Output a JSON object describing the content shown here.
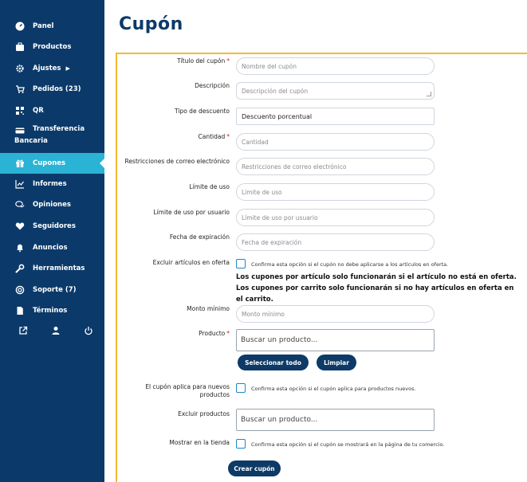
{
  "sidebar": {
    "items": [
      {
        "label": "Panel",
        "icon": "dashboard-icon"
      },
      {
        "label": "Productos",
        "icon": "briefcase-icon"
      },
      {
        "label": "Ajustes",
        "icon": "gear-icon"
      },
      {
        "label": "Pedidos (23)",
        "icon": "cart-icon"
      },
      {
        "label": "QR",
        "icon": "qr-icon"
      },
      {
        "label": "Transferencia",
        "label2": "Bancaria",
        "icon": "credit-card-icon"
      },
      {
        "label": "Cupones",
        "icon": "gift-icon",
        "active": true
      },
      {
        "label": "Informes",
        "icon": "chart-line-icon"
      },
      {
        "label": "Opiniones",
        "icon": "comments-icon"
      },
      {
        "label": "Seguidores",
        "icon": "heart-icon"
      },
      {
        "label": "Anuncios",
        "icon": "bell-icon"
      },
      {
        "label": "Herramientas",
        "icon": "wrench-icon"
      },
      {
        "label": "Soporte (7)",
        "icon": "lifebuoy-icon"
      },
      {
        "label": "Términos",
        "icon": "document-icon"
      }
    ],
    "ajustes_caret": "▶",
    "bottom_icons": [
      "external-link-icon",
      "user-icon",
      "power-icon"
    ]
  },
  "page": {
    "title": "Cupón"
  },
  "form": {
    "titulo": {
      "label": "Título del cupón",
      "required": "*",
      "placeholder": "Nombre del cupón"
    },
    "descripcion": {
      "label": "Descripción",
      "placeholder": "Descripción del cupón"
    },
    "tipo": {
      "label": "Tipo de descuento",
      "value": "Descuento porcentual"
    },
    "cantidad": {
      "label": "Cantidad",
      "required": "*",
      "placeholder": "Cantidad"
    },
    "restricciones": {
      "label": "Restricciones de correo electrónico",
      "placeholder": "Restricciones de correo electrónico"
    },
    "limite": {
      "label": "Límite de uso",
      "placeholder": "Límite de uso"
    },
    "limite_usuario": {
      "label": "Límite de uso por usuario",
      "placeholder": "Límite de uso por usuario"
    },
    "fecha": {
      "label": "Fecha de expiración",
      "placeholder": "Fecha de expiración"
    },
    "excluir_oferta": {
      "label": "Excluir artículos en oferta",
      "checkbox_text": "Confirma esta opción si el cupón no debe aplicarse a los artículos en oferta."
    },
    "notice": "Los cupones por artículo solo funcionarán si el artículo no está en oferta. Los cupones por carrito solo funcionarán si no hay artículos en oferta en el carrito.",
    "monto": {
      "label": "Monto mínimo",
      "placeholder": "Monto mínimo"
    },
    "producto": {
      "label": "Producto",
      "required": "*",
      "placeholder": "Buscar un producto..."
    },
    "seleccionar_todo": "Seleccionar todo",
    "limpiar": "Limpiar",
    "nuevos": {
      "label_line1": "El cupón aplica para nuevos",
      "label_line2": "productos",
      "checkbox_text": "Confirma esta opción si el cupón aplica para productos nuevos."
    },
    "excluir_productos": {
      "label": "Excluir productos",
      "placeholder": "Buscar un producto..."
    },
    "mostrar": {
      "label": "Mostrar en la tienda",
      "checkbox_text": "Confirma esta opción si el cupón se mostrará en la página de tu comercio."
    },
    "crear": "Crear cupón"
  },
  "colors": {
    "sidebar_bg": "#0b3a6a",
    "active_bg": "#2ab3d5",
    "card_border": "#f5b82e",
    "button_bg": "#0d3a66",
    "required": "#d0162d"
  }
}
